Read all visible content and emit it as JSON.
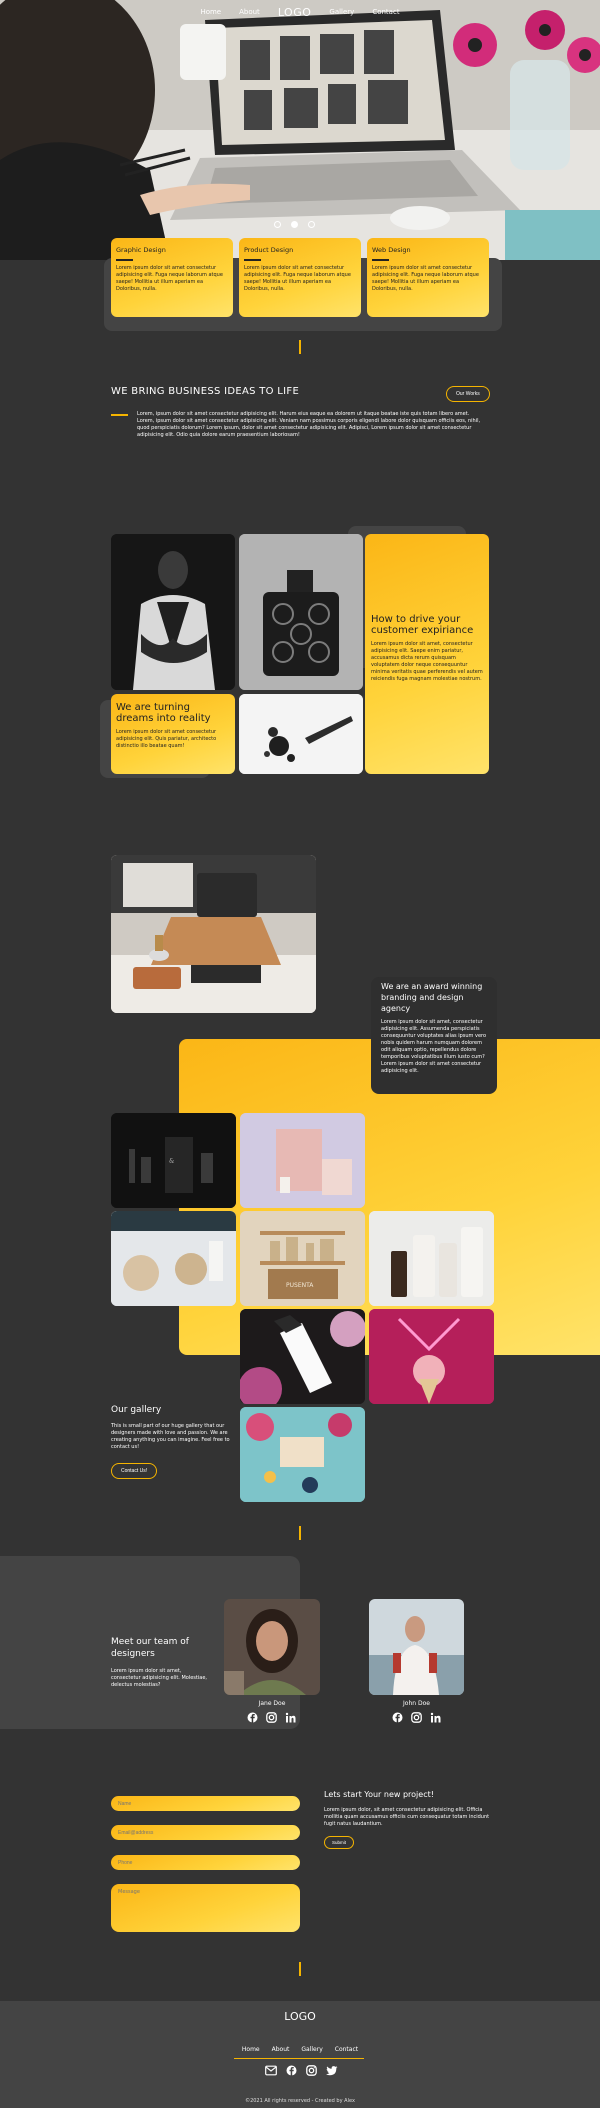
{
  "nav": {
    "left": [
      "Home",
      "About"
    ],
    "logo": "LOGO",
    "right": [
      "Gallery",
      "Contact"
    ]
  },
  "services": [
    {
      "title": "Graphic Design",
      "text": "Lorem ipsum dolor sit amet consectetur adipisicing elit. Fuga neque laborum atque saepe! Mollitia ut illum aperiam ea Doloribus, nulla."
    },
    {
      "title": "Product Design",
      "text": "Lorem ipsum dolor sit amet consectetur adipisicing elit. Fuga neque laborum atque saepe! Mollitia ut illum aperiam ea Doloribus, nulla."
    },
    {
      "title": "Web Design",
      "text": "Lorem ipsum dolor sit amet consectetur adipisicing elit. Fuga neque laborum atque saepe! Mollitia ut illum aperiam ea Doloribus, nulla."
    }
  ],
  "intro": {
    "heading": "WE BRING BUSINESS IDEAS TO LIFE",
    "button": "Our Works",
    "text": "Lorem, ipsum dolor sit amet consectetur adipisicing elit. Harum eius eaque ea dolorem ut itaque beatae iste quis totam libero amet. Lorem, ipsum dolor sit amet consectetur adipisicing elit. Veniam nam possimus corporis eligendi labore dolor quisquam officiis eos, nihil, quod perspiciatis dolorum? Lorem ipsum, dolor sit amet consectetur adipisicing elit. Adipisci, Lorem ipsum dolor sit amet consectetur adipisicing elit. Odio quia dolore earum praesentium laboriosam!"
  },
  "features": {
    "dreams_title": "We are turning dreams into reality",
    "dreams_text": "Lorem ipsum dolor sit amet consectetur adipisicing elit. Quis pariatur, architecto distinctio illo beatae quam!",
    "drive_title": "How to drive your customer expiriance",
    "drive_text": "Lorem ipsum dolor sit amet, consectetur adipisicing elit. Saepe enim pariatur, accusamus dicta rerum quisquam voluptatem dolor neque consequuntur minima veritatis quae perferendis vel autem reiciendis fuga magnam molestiae nostrum."
  },
  "award": {
    "title": "We are an award winning branding and design agency",
    "text": "Lorem ipsum dolor sit amet, consectetur adipisicing elit. Assumenda perspiciatis consequuntur voluptates alias ipsum vero nobis quidem harum numquam dolorem odit aliquam optio, repellendus dolore temporibus voluptatibus illum iusto cum? Lorem ipsum dolor sit amet consectetur adipisicing elit."
  },
  "gallery": {
    "title": "Our gallery",
    "text": "This is small part of our huge gallery that our designers made with love and passion. We are creating anything you can imagine. Feel free to contact us!",
    "button": "Contact Us!"
  },
  "team": {
    "title": "Meet our team of designers",
    "text": "Lorem ipsum dolor sit amet, consectetur adipisicing elit. Molestiae, delectus molestias?",
    "members": [
      {
        "name": "Jane Doe"
      },
      {
        "name": "John Doe"
      }
    ]
  },
  "contact": {
    "fields": [
      {
        "placeholder": "Name"
      },
      {
        "placeholder": "Email@address"
      },
      {
        "placeholder": "Phone"
      }
    ],
    "message_placeholder": "Message",
    "title": "Lets start Your new project!",
    "text": "Lorem ipsum dolor, sit amet consectetur adipisicing elit. Officia mollitia quam accusamus officiis cum consequatur totam incidunt fugit natus laudantium.",
    "submit": "Submit"
  },
  "footer": {
    "logo": "LOGO",
    "links": [
      "Home",
      "About",
      "Gallery",
      "Contact"
    ],
    "copyright": "©2021 All rights reserved - Created by Alex"
  },
  "colors": {
    "background": "#333333",
    "accent": "#fbb616",
    "panel": "#444444"
  }
}
